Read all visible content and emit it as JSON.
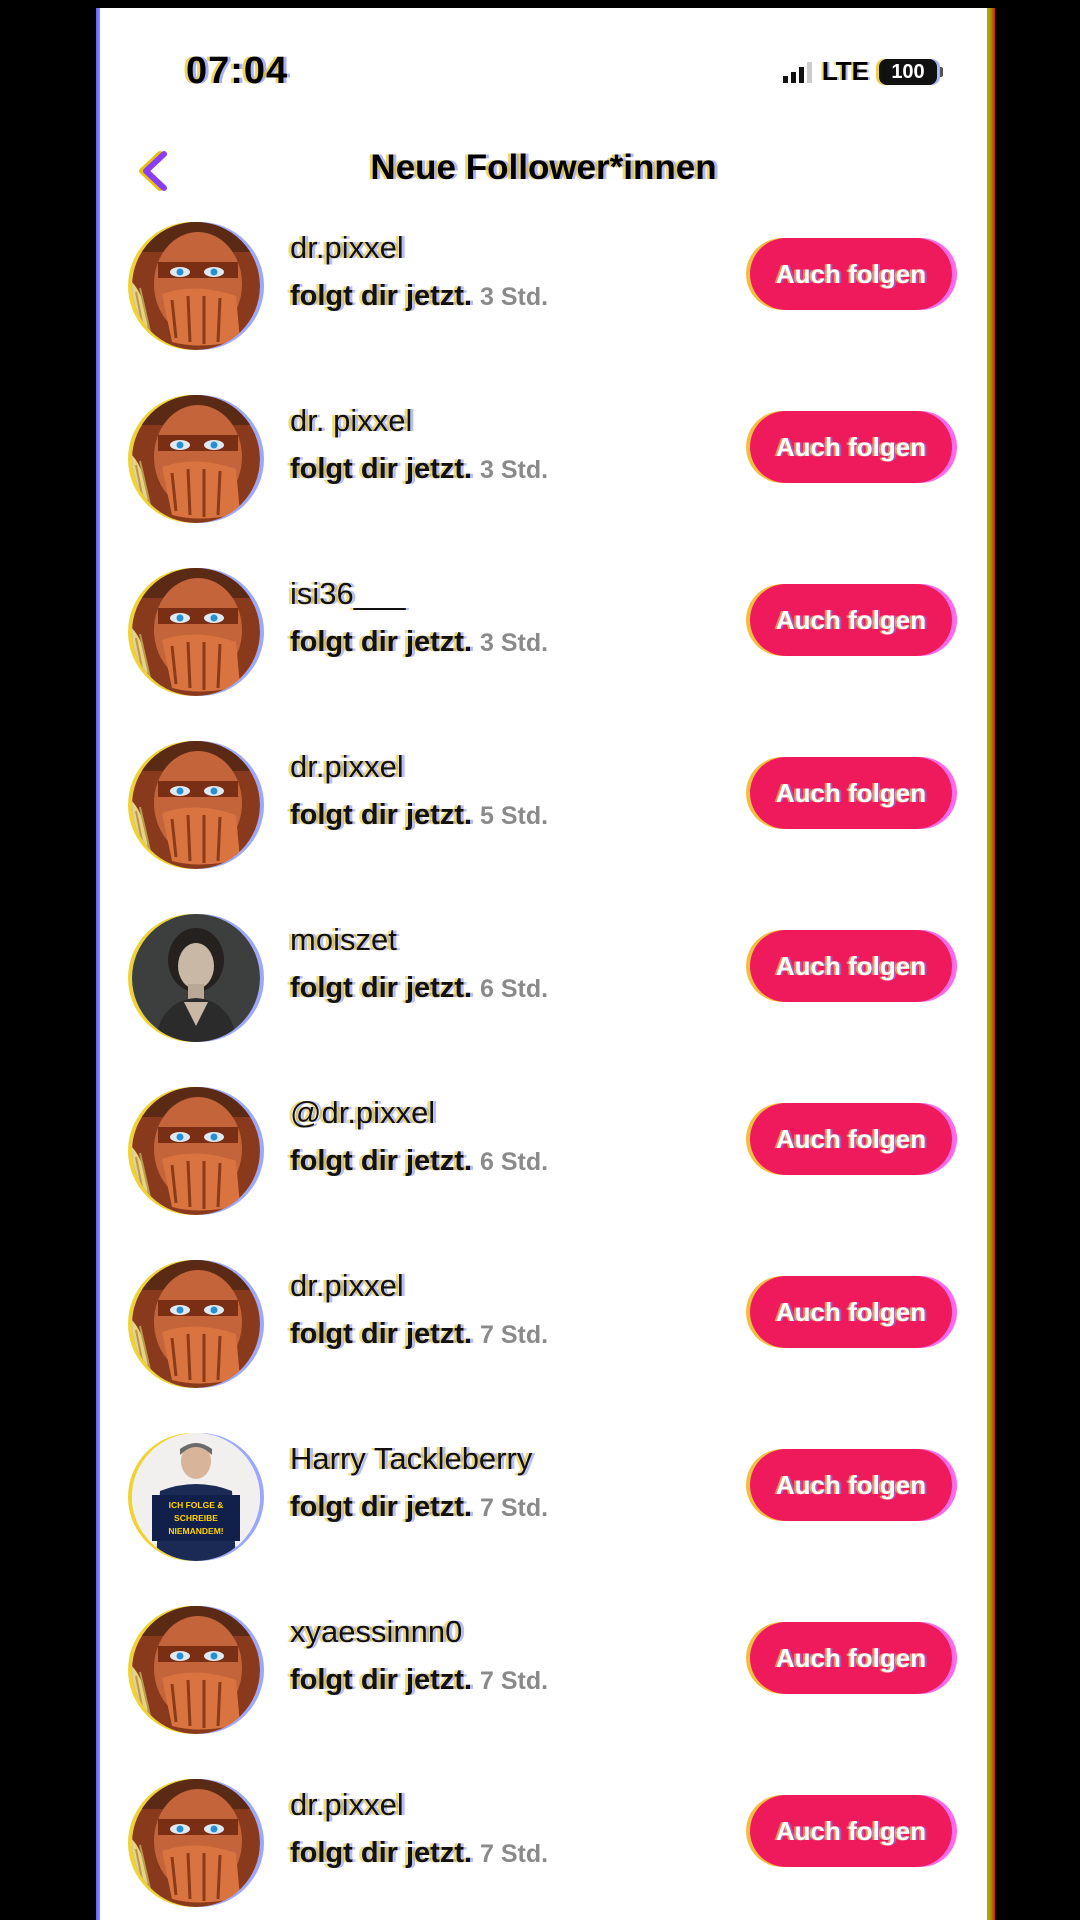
{
  "status_bar": {
    "time": "07:04",
    "network": "LTE",
    "battery": "100"
  },
  "header": {
    "title": "Neue Follower*innen",
    "back_icon": "chevron-left-icon"
  },
  "colors": {
    "accent": "#ee1a5c",
    "back_icon": "#8a3cff"
  },
  "followers": [
    {
      "name": "dr.pixxel",
      "action": "folgt dir jetzt.",
      "time": "3 Std.",
      "button": "Auch folgen",
      "avatar": "masked-man"
    },
    {
      "name": "dr. pixxel",
      "action": "folgt dir jetzt.",
      "time": "3 Std.",
      "button": "Auch folgen",
      "avatar": "masked-man"
    },
    {
      "name": "isi36___",
      "action": "folgt dir jetzt.",
      "time": "3 Std.",
      "button": "Auch folgen",
      "avatar": "masked-man"
    },
    {
      "name": "dr.pixxel",
      "action": "folgt dir jetzt.",
      "time": "5 Std.",
      "button": "Auch folgen",
      "avatar": "masked-man"
    },
    {
      "name": "moiszet",
      "action": "folgt dir jetzt.",
      "time": "6 Std.",
      "button": "Auch folgen",
      "avatar": "woman-portrait"
    },
    {
      "name": "@dr.pixxel",
      "action": "folgt dir jetzt.",
      "time": "6 Std.",
      "button": "Auch folgen",
      "avatar": "masked-man"
    },
    {
      "name": "dr.pixxel",
      "action": "folgt dir jetzt.",
      "time": "7 Std.",
      "button": "Auch folgen",
      "avatar": "masked-man"
    },
    {
      "name": "Harry Tackleberry",
      "action": "folgt dir jetzt.",
      "time": "7 Std.",
      "button": "Auch folgen",
      "avatar": "man-with-sign",
      "avatar_text": "ICH FOLGE & SCHREIBE NIEMANDEM!"
    },
    {
      "name": "xyaessinnn0",
      "action": "folgt dir jetzt.",
      "time": "7 Std.",
      "button": "Auch folgen",
      "avatar": "masked-man"
    },
    {
      "name": "dr.pixxel",
      "action": "folgt dir jetzt.",
      "time": "7 Std.",
      "button": "Auch folgen",
      "avatar": "masked-man"
    }
  ]
}
